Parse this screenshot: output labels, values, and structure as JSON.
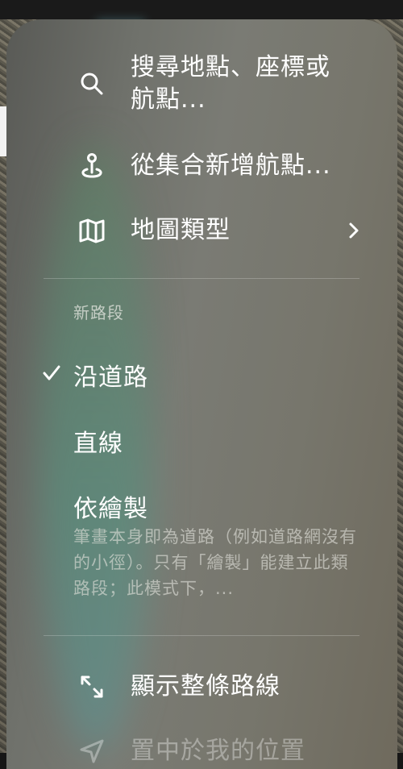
{
  "menu": {
    "search": {
      "label": "搜尋地點、座標或\n航點..."
    },
    "add_waypoint": {
      "label": "從集合新增航點..."
    },
    "map_type": {
      "label": "地圖類型"
    },
    "new_segment": {
      "title": "新路段",
      "options": [
        {
          "label": "沿道路",
          "selected": true
        },
        {
          "label": "直線",
          "selected": false
        },
        {
          "label": "依繪製",
          "selected": false,
          "description": "筆畫本身即為道路（例如道路網沒有的小徑）。只有「繪製」能建立此類路段；此模式下，..."
        }
      ]
    },
    "show_route": {
      "label": "顯示整條路線"
    },
    "center_location": {
      "label": "置中於我的位置"
    }
  },
  "icons": {
    "search": "search-icon",
    "waypoint": "waypoint-pin-icon",
    "map": "map-icon",
    "chevron": "chevron-right-icon",
    "check": "checkmark-icon",
    "expand": "expand-arrows-icon",
    "location": "location-arrow-icon"
  },
  "colors": {
    "text": "#ffffff",
    "secondary_text": "#dcdcd6",
    "sheet": "#707169"
  }
}
